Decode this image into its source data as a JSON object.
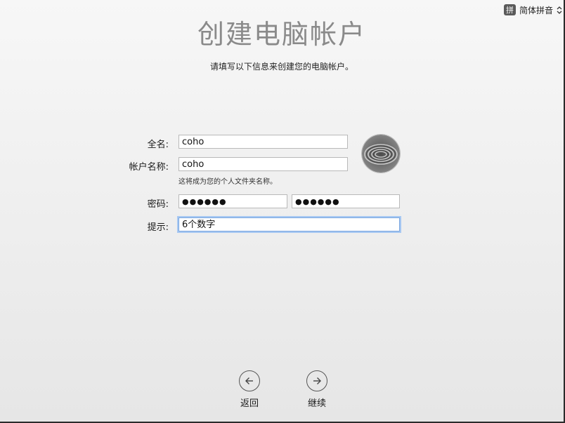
{
  "input_method": {
    "badge": "拼",
    "name": "简体拼音"
  },
  "header": {
    "title": "创建电脑帐户",
    "subtitle": "请填写以下信息来创建您的电脑帐户。"
  },
  "form": {
    "full_name_label": "全名:",
    "full_name_value": "coho",
    "account_name_label": "帐户名称:",
    "account_name_value": "coho",
    "account_name_hint": "这将成为您的个人文件夹名称。",
    "password_label": "密码:",
    "password_value": "●●●●●●",
    "password_confirm_value": "●●●●●●",
    "hint_label": "提示:",
    "hint_value": "6个数字"
  },
  "navigation": {
    "back_label": "返回",
    "continue_label": "继续"
  }
}
